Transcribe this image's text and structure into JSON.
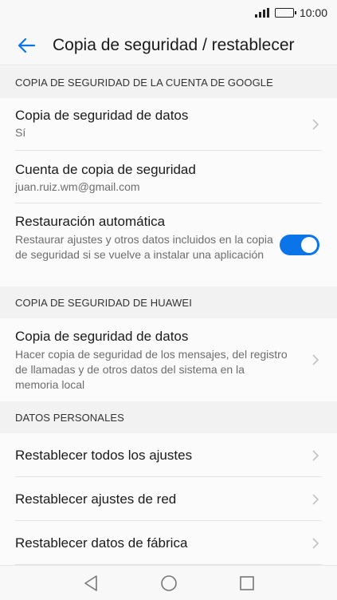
{
  "status_bar": {
    "time": "10:00"
  },
  "app_bar": {
    "title": "Copia de seguridad / restablecer"
  },
  "sections": [
    {
      "header": "COPIA DE SEGURIDAD DE LA CUENTA DE GOOGLE",
      "items": [
        {
          "title": "Copia de seguridad de datos",
          "subtitle": "Sí"
        },
        {
          "title": "Cuenta de copia de seguridad",
          "subtitle": "juan.ruiz.wm@gmail.com"
        },
        {
          "title": "Restauración automática",
          "subtitle": "Restaurar ajustes y otros datos incluidos en la copia de seguridad si se vuelve a instalar una aplicación",
          "toggle_on": true
        }
      ]
    },
    {
      "header": "COPIA DE SEGURIDAD DE HUAWEI",
      "items": [
        {
          "title": "Copia de seguridad de datos",
          "subtitle": "Hacer copia de seguridad de los mensajes, del registro de llamadas y de otros datos del sistema en la memoria local"
        }
      ]
    },
    {
      "header": "DATOS PERSONALES",
      "items": [
        {
          "title": "Restablecer todos los ajustes"
        },
        {
          "title": "Restablecer ajustes de red"
        },
        {
          "title": "Restablecer datos de fábrica"
        }
      ]
    }
  ],
  "colors": {
    "accent": "#0a74e8"
  }
}
